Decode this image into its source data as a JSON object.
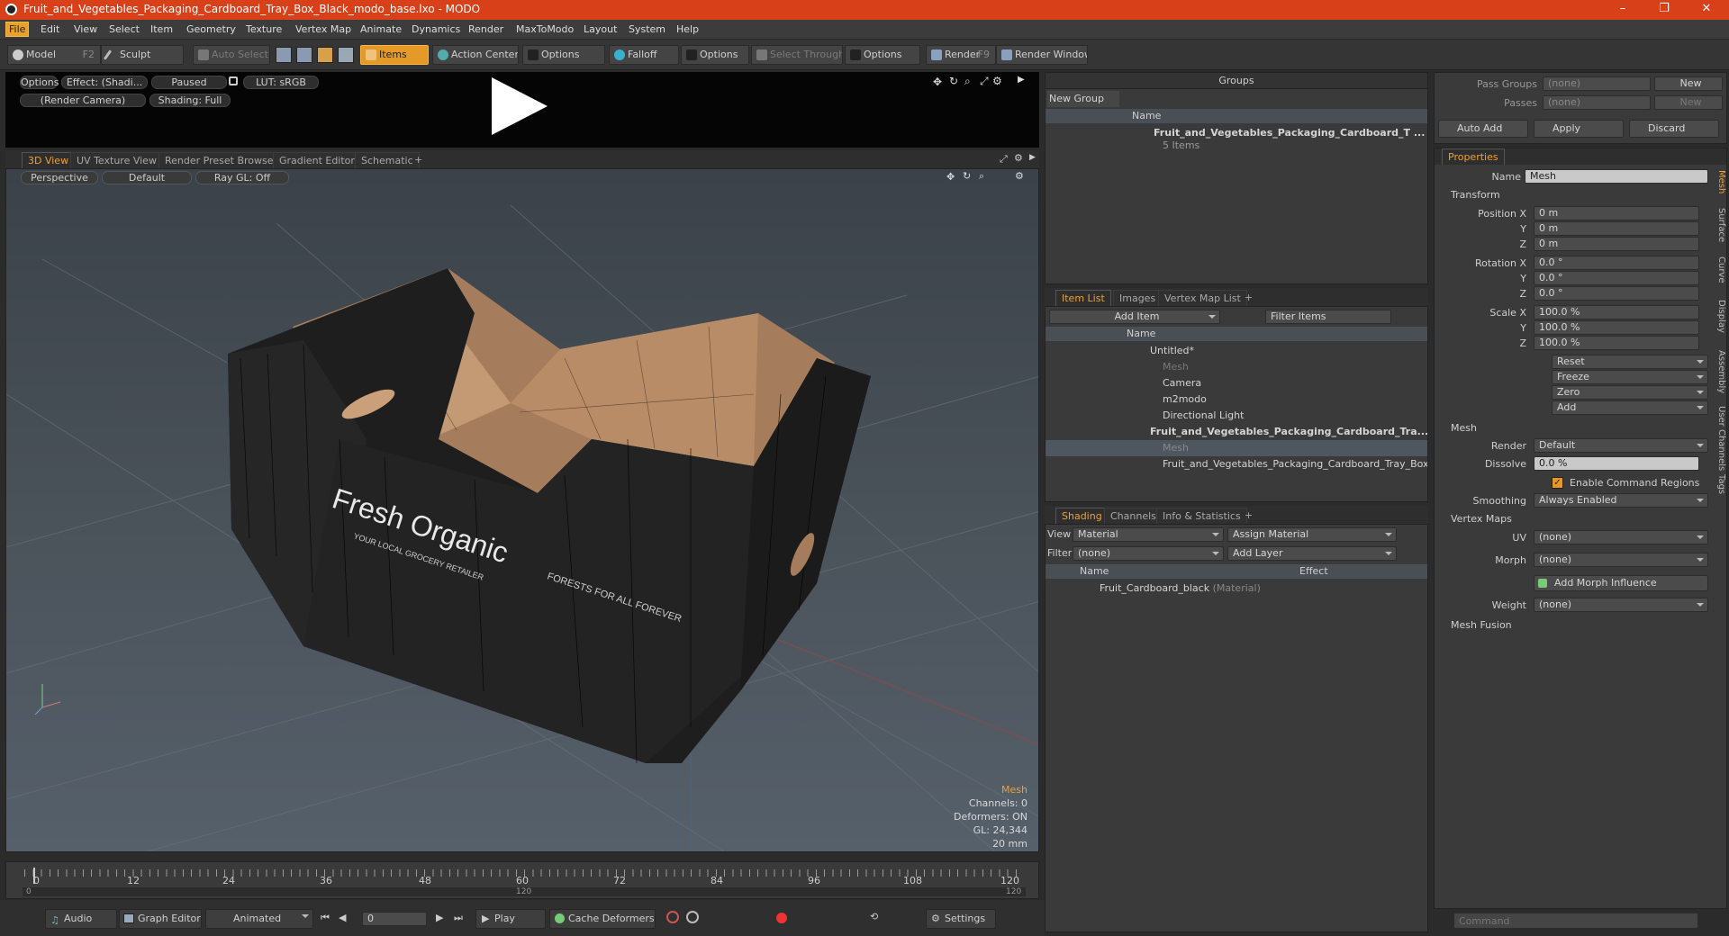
{
  "window": {
    "title": "Fruit_and_Vegetables_Packaging_Cardboard_Tray_Box_Black_modo_base.lxo - MODO"
  },
  "menu": [
    "File",
    "Edit",
    "View",
    "Select",
    "Item",
    "Geometry",
    "Texture",
    "Vertex Map",
    "Animate",
    "Dynamics",
    "Render",
    "MaxToModo",
    "Layout",
    "System",
    "Help"
  ],
  "toolbar": {
    "model": "Model",
    "model_key": "F2",
    "sculpt": "Sculpt",
    "auto_select": "Auto Select",
    "items": "Items",
    "action_center": "Action Center",
    "options1": "Options",
    "falloff": "Falloff",
    "options2": "Options",
    "select_through": "Select Through",
    "options3": "Options",
    "render": "Render",
    "render_key": "F9",
    "render_window": "Render Window"
  },
  "preview": {
    "options": "Options",
    "effect": "Effect: (Shadi...",
    "paused": "Paused",
    "lut": "LUT: sRGB",
    "camera": "(Render Camera)",
    "shading": "Shading: Full"
  },
  "viewport_tabs": [
    "3D View",
    "UV Texture View",
    "Render Preset Browser",
    "Gradient Editor",
    "Schematic",
    "+"
  ],
  "viewport": {
    "perspective": "Perspective",
    "default": "Default",
    "raygl": "Ray GL: Off",
    "box_text1": "Fresh Organic",
    "box_text2": "YOUR LOCAL GROCERY RETAILER",
    "box_text3": "FORESTS FOR ALL FOREVER",
    "hud": {
      "mesh": "Mesh",
      "channels": "Channels: 0",
      "deformers": "Deformers: ON",
      "gl": "GL: 24,344",
      "scale": "20 mm"
    }
  },
  "timeline": {
    "ticks": [
      "0",
      "12",
      "24",
      "36",
      "48",
      "60",
      "72",
      "84",
      "96",
      "108",
      "120"
    ],
    "sub_ticks": [
      "0",
      "120",
      "120"
    ]
  },
  "bottom": {
    "audio": "Audio",
    "graph_editor": "Graph Editor",
    "animated": "Animated",
    "frame": "0",
    "play": "Play",
    "cache_deformers": "Cache Deformers",
    "settings": "Settings"
  },
  "groups": {
    "title": "Groups",
    "new_group": "New Group",
    "col_name": "Name",
    "item_name": "Fruit_and_Vegetables_Packaging_Cardboard_T ...",
    "item_sub": "5 Items"
  },
  "itemlist": {
    "tabs": [
      "Item List",
      "Images",
      "Vertex Map List",
      "+"
    ],
    "add_item": "Add Item",
    "filter": "Filter Items",
    "col_name": "Name",
    "rows": [
      {
        "label": "Untitled*",
        "indent": 0
      },
      {
        "label": "Mesh",
        "indent": 1,
        "dim": true
      },
      {
        "label": "Camera",
        "indent": 1
      },
      {
        "label": "m2modo",
        "indent": 1
      },
      {
        "label": "Directional Light",
        "indent": 1
      },
      {
        "label": "Fruit_and_Vegetables_Packaging_Cardboard_Tra...",
        "indent": 0,
        "bold": true
      },
      {
        "label": "Mesh",
        "indent": 1,
        "dim": true,
        "selected": true
      },
      {
        "label": "Fruit_and_Vegetables_Packaging_Cardboard_Tray_Box ...",
        "indent": 1
      }
    ]
  },
  "shading": {
    "tabs": [
      "Shading",
      "Channels",
      "Info & Statistics",
      "+"
    ],
    "view_label": "View",
    "view_value": "Material",
    "assign": "Assign Material",
    "filter_label": "Filter",
    "filter_value": "(none)",
    "add_layer": "Add Layer",
    "col_name": "Name",
    "col_effect": "Effect",
    "material": "Fruit_Cardboard_black",
    "material_type": "(Material)"
  },
  "passes": {
    "pass_groups": "Pass Groups",
    "pass_value": "(none)",
    "new": "New",
    "passes": "Passes",
    "passes_value": "(none)",
    "new2": "New",
    "auto_add": "Auto Add",
    "apply": "Apply",
    "discard": "Discard"
  },
  "properties": {
    "tab": "Properties",
    "name_label": "Name",
    "name_value": "Mesh",
    "transform": "Transform",
    "position_label": "Position X",
    "pos": [
      "0 m",
      "0 m",
      "0 m"
    ],
    "rotation_label": "Rotation X",
    "rot": [
      "0.0 °",
      "0.0 °",
      "0.0 °"
    ],
    "scale_label": "Scale X",
    "scale": [
      "100.0 %",
      "100.0 %",
      "100.0 %"
    ],
    "y": "Y",
    "z": "Z",
    "reset": "Reset",
    "freeze": "Freeze",
    "zero": "Zero",
    "add": "Add",
    "mesh_section": "Mesh",
    "render_label": "Render",
    "render_value": "Default",
    "dissolve_label": "Dissolve",
    "dissolve_value": "0.0 %",
    "enable_regions": "Enable Command Regions",
    "smoothing_label": "Smoothing",
    "smoothing_value": "Always Enabled",
    "vertex_maps": "Vertex Maps",
    "uv_label": "UV",
    "uv_value": "(none)",
    "morph_label": "Morph",
    "morph_value": "(none)",
    "add_morph": "Add Morph Influence",
    "weight_label": "Weight",
    "weight_value": "(none)",
    "mesh_fusion": "Mesh Fusion",
    "side_tabs": [
      "Mesh",
      "Surface",
      "Curve",
      "Display",
      "Assembly",
      "User Channels",
      "Tags"
    ]
  },
  "command": {
    "placeholder": "Command"
  },
  "colors": {
    "accent": "#e59a27",
    "title_bar": "#d8401a"
  }
}
